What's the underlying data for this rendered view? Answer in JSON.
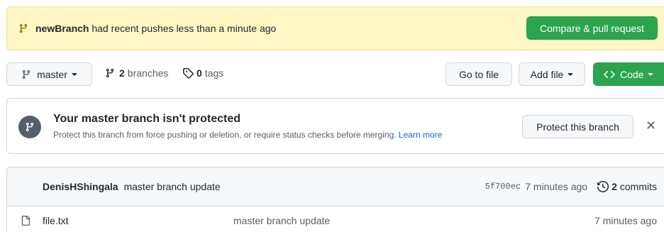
{
  "banner": {
    "branch_name": "newBranch",
    "message": "had recent pushes less than a minute ago",
    "compare_label": "Compare & pull request"
  },
  "toolbar": {
    "branch_select_label": "master",
    "branches_count": "2",
    "branches_label": "branches",
    "tags_count": "0",
    "tags_label": "tags",
    "go_to_file_label": "Go to file",
    "add_file_label": "Add file",
    "code_label": "Code"
  },
  "protection": {
    "title": "Your master branch isn't protected",
    "description": "Protect this branch from force pushing or deletion, or require status checks before merging.",
    "learn_more": "Learn more",
    "button_label": "Protect this branch",
    "close_glyph": "✕"
  },
  "latest_commit": {
    "author": "DenisHShingala",
    "message": "master branch update",
    "sha": "5f700ec",
    "age": "7 minutes ago",
    "commits_count": "2",
    "commits_label": "commits"
  },
  "files": [
    {
      "name": "file.txt",
      "commit_message": "master branch update",
      "age": "7 minutes ago"
    }
  ],
  "colors": {
    "banner_bg": "#fff8c5",
    "primary_green": "#2da44e",
    "link_blue": "#0969da"
  }
}
